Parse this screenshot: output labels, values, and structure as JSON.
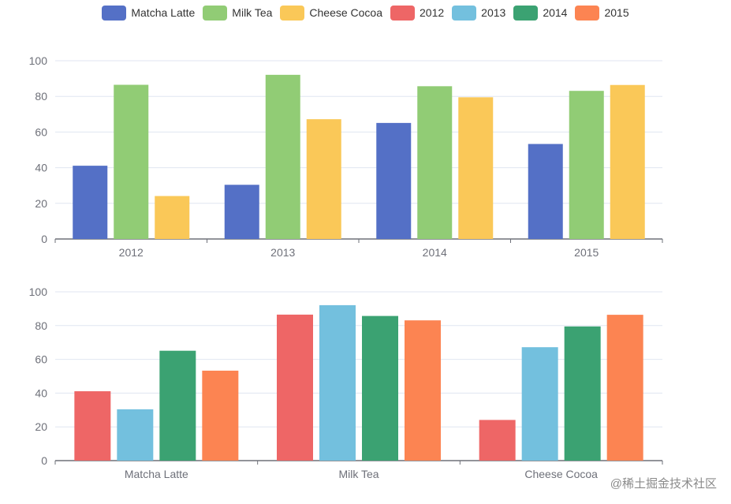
{
  "legend": [
    {
      "name": "Matcha Latte",
      "color": "#5470c6"
    },
    {
      "name": "Milk Tea",
      "color": "#91cc75"
    },
    {
      "name": "Cheese Cocoa",
      "color": "#fac858"
    },
    {
      "name": "2012",
      "color": "#ee6666"
    },
    {
      "name": "2013",
      "color": "#73c0de"
    },
    {
      "name": "2014",
      "color": "#3ba272"
    },
    {
      "name": "2015",
      "color": "#fc8452"
    }
  ],
  "watermark": "@稀土掘金技术社区",
  "chart_data": [
    {
      "type": "bar",
      "title": "",
      "xlabel": "",
      "ylabel": "",
      "ylim": [
        0,
        100
      ],
      "yticks": [
        0,
        20,
        40,
        60,
        80,
        100
      ],
      "grid": true,
      "legend_position": "top-center",
      "categories": [
        "2012",
        "2013",
        "2014",
        "2015"
      ],
      "series": [
        {
          "name": "Matcha Latte",
          "color": "#5470c6",
          "values": [
            41.1,
            30.4,
            65.1,
            53.3
          ]
        },
        {
          "name": "Milk Tea",
          "color": "#91cc75",
          "values": [
            86.5,
            92.1,
            85.7,
            83.1
          ]
        },
        {
          "name": "Cheese Cocoa",
          "color": "#fac858",
          "values": [
            24.1,
            67.2,
            79.5,
            86.4
          ]
        }
      ]
    },
    {
      "type": "bar",
      "title": "",
      "xlabel": "",
      "ylabel": "",
      "ylim": [
        0,
        100
      ],
      "yticks": [
        0,
        20,
        40,
        60,
        80,
        100
      ],
      "grid": true,
      "legend_position": "top-center",
      "categories": [
        "Matcha Latte",
        "Milk Tea",
        "Cheese Cocoa"
      ],
      "series": [
        {
          "name": "2012",
          "color": "#ee6666",
          "values": [
            41.1,
            86.5,
            24.1
          ]
        },
        {
          "name": "2013",
          "color": "#73c0de",
          "values": [
            30.4,
            92.1,
            67.2
          ]
        },
        {
          "name": "2014",
          "color": "#3ba272",
          "values": [
            65.1,
            85.7,
            79.5
          ]
        },
        {
          "name": "2015",
          "color": "#fc8452",
          "values": [
            53.3,
            83.1,
            86.4
          ]
        }
      ]
    }
  ]
}
